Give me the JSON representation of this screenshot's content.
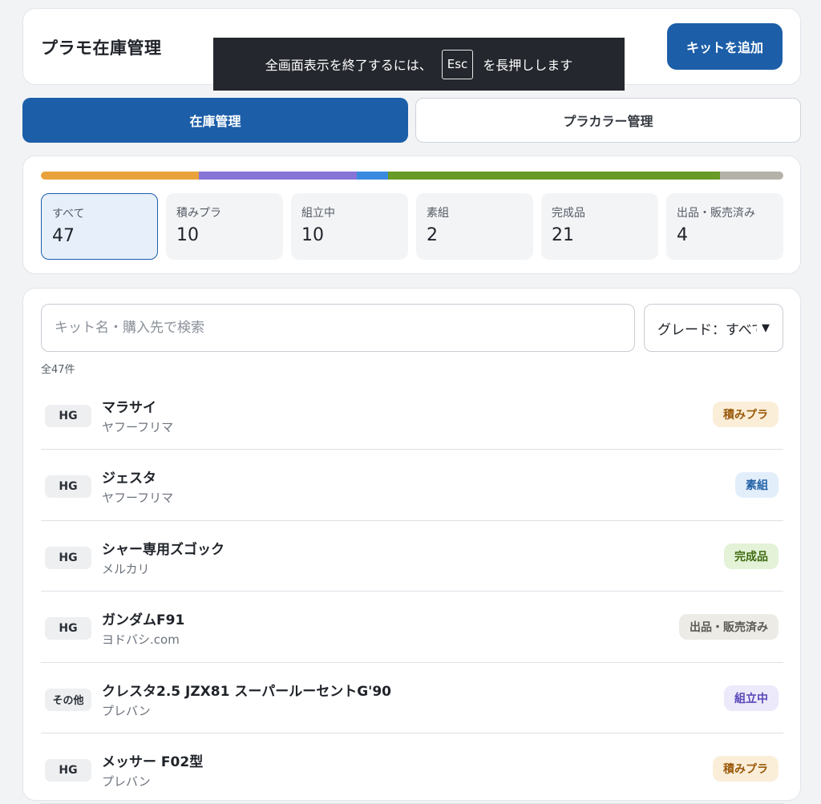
{
  "header": {
    "title": "プラモ在庫管理",
    "add_button": "キットを追加"
  },
  "fullscreen_toast": {
    "before": "全画面表示を終了するには、",
    "key": "Esc",
    "after": "を長押しします"
  },
  "tabs": [
    {
      "label": "在庫管理",
      "active": true
    },
    {
      "label": "プラカラー管理",
      "active": false
    }
  ],
  "progress_colors": [
    "#e9a23b",
    "#8674d6",
    "#3a8be0",
    "#689a25",
    "#b4b2a8"
  ],
  "stats": [
    {
      "label": "すべて",
      "value": "47",
      "active": true
    },
    {
      "label": "積みプラ",
      "value": "10"
    },
    {
      "label": "組立中",
      "value": "10"
    },
    {
      "label": "素組",
      "value": "2"
    },
    {
      "label": "完成品",
      "value": "21"
    },
    {
      "label": "出品・販売済み",
      "value": "4"
    }
  ],
  "search": {
    "placeholder": "キット名・購入先で検索",
    "value": ""
  },
  "grade_filter": {
    "selected": "グレード：すべて"
  },
  "count_label": "全47件",
  "kits": [
    {
      "grade": "HG",
      "name": "マラサイ",
      "shop": "ヤフーフリマ",
      "status": "積みプラ"
    },
    {
      "grade": "HG",
      "name": "ジェスタ",
      "shop": "ヤフーフリマ",
      "status": "素組"
    },
    {
      "grade": "HG",
      "name": "シャー専用ズゴック",
      "shop": "メルカリ",
      "status": "完成品"
    },
    {
      "grade": "HG",
      "name": "ガンダムF91",
      "shop": "ヨドバシ.com",
      "status": "出品・販売済み"
    },
    {
      "grade": "その他",
      "name": "クレスタ2.5 JZX81 スーパールーセントG'90",
      "shop": "プレバン",
      "status": "組立中"
    },
    {
      "grade": "HG",
      "name": "メッサー F02型",
      "shop": "プレバン",
      "status": "積みプラ"
    }
  ],
  "status_colors": {
    "積みプラ": {
      "bg": "#fbeed9",
      "fg": "#9a5a0c"
    },
    "素組": {
      "bg": "#e3eefb",
      "fg": "#2563a8"
    },
    "完成品": {
      "bg": "#e4f2d8",
      "fg": "#3f6b12"
    },
    "出品・販売済み": {
      "bg": "#ecebe6",
      "fg": "#5b5a55"
    },
    "組立中": {
      "bg": "#ece9fb",
      "fg": "#5a46b8"
    }
  }
}
